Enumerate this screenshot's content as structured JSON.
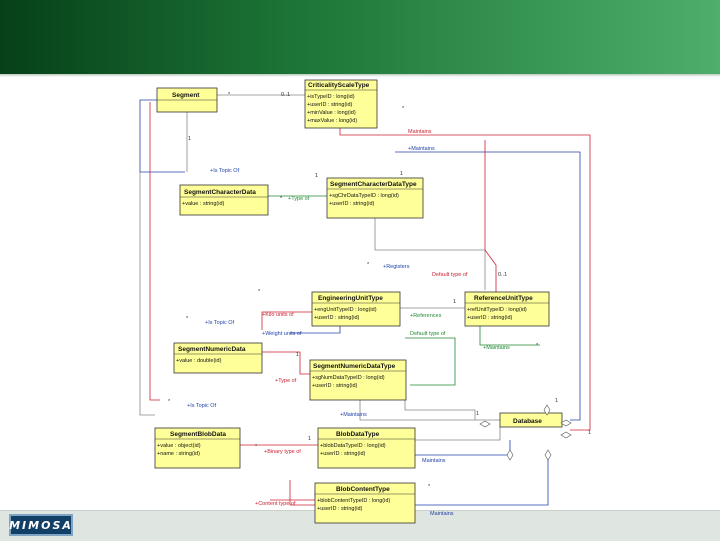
{
  "colors": {
    "header_start": "#064018",
    "header_end": "#4fae6c",
    "class_fill": "#ffff99",
    "class_border": "#333333",
    "line_red": "#cc2233",
    "line_blue": "#2244aa",
    "line_green": "#228833",
    "line_gray": "#888888"
  },
  "logo": {
    "text": "MIMOSA"
  },
  "classes": {
    "segment": {
      "name": "Segment",
      "attrs": []
    },
    "criticality_scale_type": {
      "name": "CriticalityScaleType",
      "attrs": [
        "+isTypeID : long(id)",
        "+userID : string(id)",
        "+minValue : long(id)",
        "+maxValue : long(id)"
      ]
    },
    "segment_character_data": {
      "name": "SegmentCharacterData",
      "attrs": [
        "+value : string(id)"
      ]
    },
    "segment_character_data_type": {
      "name": "SegmentCharacterDataType",
      "attrs": [
        "+sgChrDataTypeID : long(id)",
        "+userID : string(id)"
      ]
    },
    "engineering_unit_type": {
      "name": "EngineeringUnitType",
      "attrs": [
        "+engUnitTypeID : long(id)",
        "+userID : string(id)"
      ]
    },
    "reference_unit_type": {
      "name": "ReferenceUnitType",
      "attrs": [
        "+refUnitTypeID : long(id)",
        "+userID : string(id)"
      ]
    },
    "segment_numeric_data": {
      "name": "SegmentNumericData",
      "attrs": [
        "+value : double(id)"
      ]
    },
    "segment_numeric_data_type": {
      "name": "SegmentNumericDataType",
      "attrs": [
        "+sgNumDataTypeID : long(id)",
        "+userID : string(id)"
      ]
    },
    "segment_blob_data": {
      "name": "SegmentBlobData",
      "attrs": [
        "+value : object(id)",
        "+name : string(id)"
      ]
    },
    "blob_data_type": {
      "name": "BlobDataType",
      "attrs": [
        "+blobDataTypeID : long(id)",
        "+userID : string(id)"
      ]
    },
    "database": {
      "name": "Database",
      "attrs": []
    },
    "blob_content_type": {
      "name": "BlobContentType",
      "attrs": [
        "+blobContentTypeID : long(id)",
        "+userID : string(id)"
      ]
    }
  },
  "labels": {
    "maintains_red": "Maintains",
    "maintains_blue": "+Maintains",
    "is_topic_of_1": "+Is Topic Of",
    "is_topic_of_2": "+Is Topic Of",
    "is_topic_of_3": "+Is Topic Of",
    "type_of_1": "+Type of",
    "type_of_2": "+Type of",
    "registers": "+Registers",
    "default_type_of_1": "Default type of",
    "default_type_of_2": "Default type of",
    "kilo_units_of": "+Kilo units of",
    "references": "+References",
    "weight_units_of": "+Weight units of",
    "maintains_green": "+Maintains",
    "maintains_3": "+Maintains",
    "binary_type_of": "+Binary type of",
    "maintains_4": "Maintains",
    "content_type_of": "+Content type of",
    "maintains_5": "Maintains"
  },
  "multiplicities": {
    "m1": "*",
    "m2": "0..1",
    "m3": "1",
    "m4": "1",
    "m5": "*",
    "m6": "*",
    "m7": "1",
    "m8": "*",
    "m9": "0..1",
    "m10": "*",
    "m11": "1",
    "m12": "*",
    "m13": "1",
    "m14": "*",
    "m15": "1",
    "m16": "*",
    "m17": "1",
    "m18": "*",
    "m19": "1",
    "m20": "1",
    "m21": "*"
  }
}
